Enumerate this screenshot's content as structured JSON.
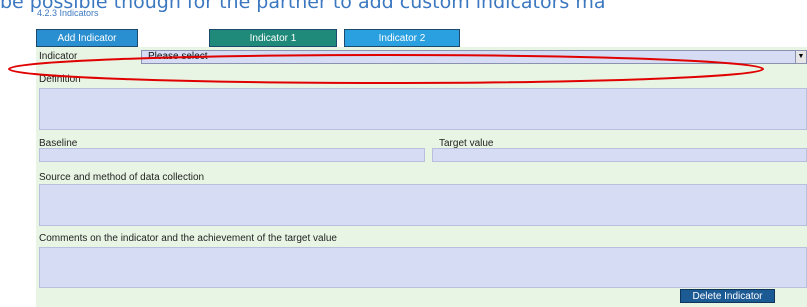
{
  "page": {
    "intro_text": "be possible though for the partner to add custom indicators ma",
    "section_label": "4.2.3 Indicators"
  },
  "tabs": [
    {
      "label": "Add Indicator",
      "color": "#2a8fd0"
    },
    {
      "label": "Indicator 1",
      "color": "#1f8a7a"
    },
    {
      "label": "Indicator 2",
      "color": "#2aa0e0"
    }
  ],
  "form": {
    "indicator_label": "Indicator",
    "indicator_value": "Please select",
    "definition_label": "Definition",
    "baseline_label": "Baseline",
    "target_label": "Target value",
    "source_label": "Source and method of data collection",
    "comments_label": "Comments on the indicator and the achievement of the target value",
    "delete_button": "Delete Indicator"
  },
  "colors": {
    "panel": "#e8f5e4",
    "field": "#d5dcf4",
    "annotation_ellipse": "#e00000",
    "button": "#1c5a94"
  }
}
